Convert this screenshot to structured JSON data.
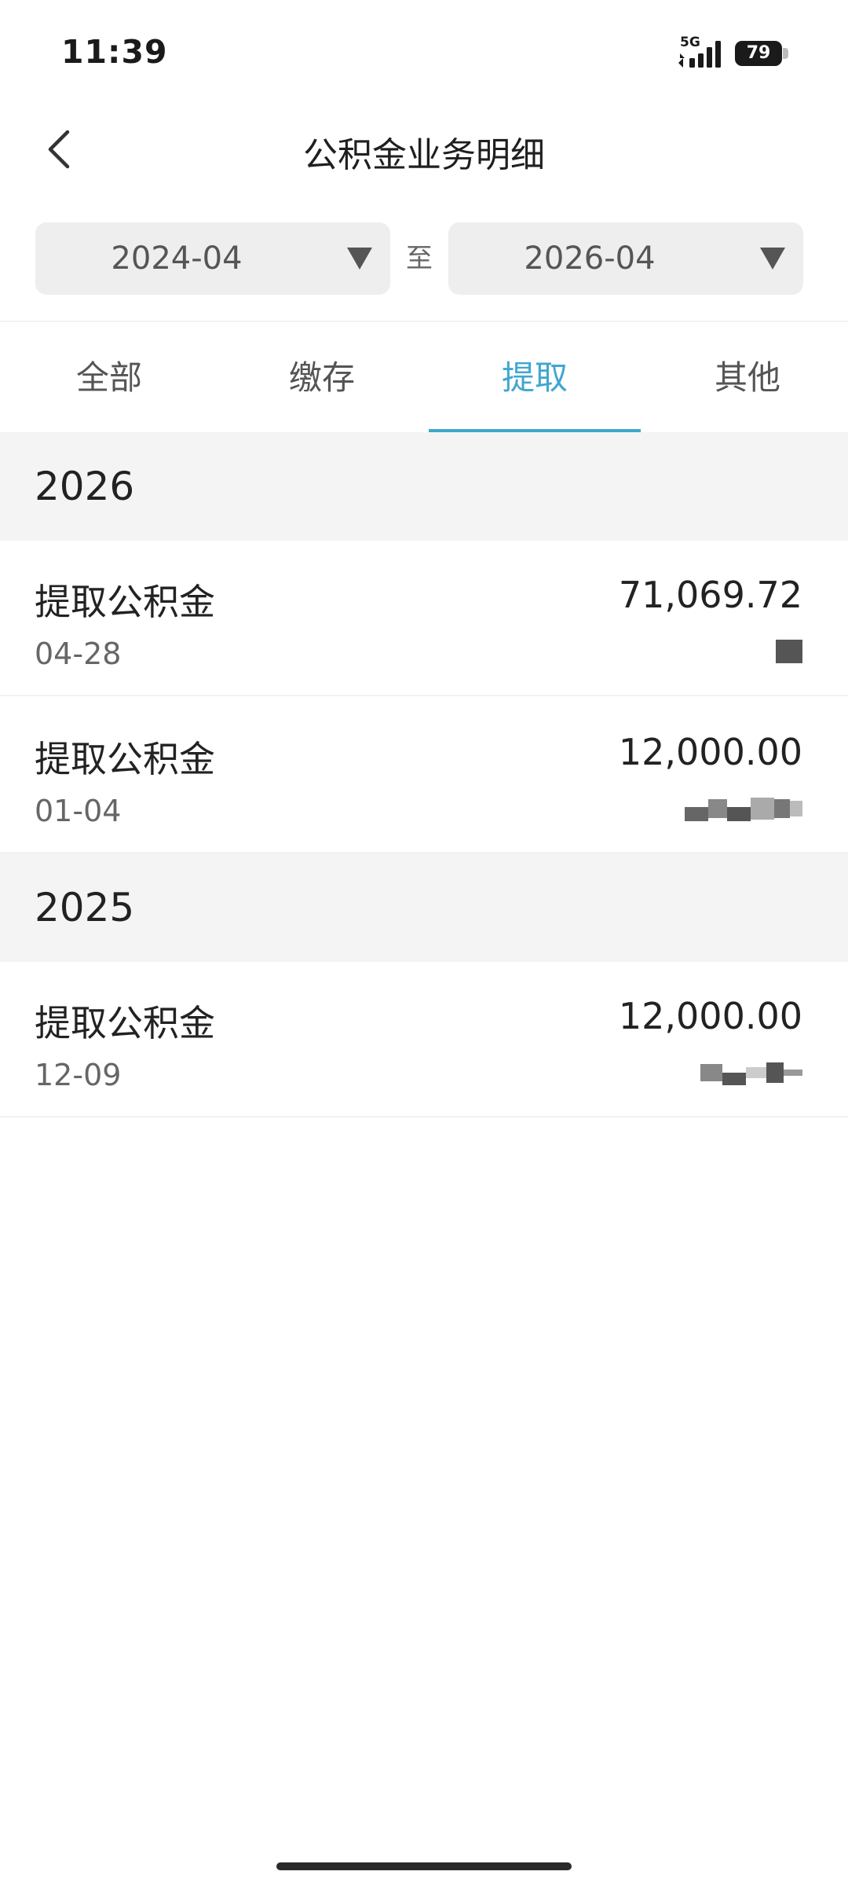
{
  "status_bar": {
    "time": "11:39",
    "network": "5G",
    "battery": "79"
  },
  "header": {
    "title": "公积金业务明细",
    "back_icon": "chevron-left-icon"
  },
  "date_range": {
    "start": "2024-04",
    "separator": "至",
    "end": "2026-04"
  },
  "tabs": [
    {
      "label": "全部"
    },
    {
      "label": "缴存"
    },
    {
      "label": "提取"
    },
    {
      "label": "其他"
    }
  ],
  "active_tab": "提取",
  "accent_color": "#3fa7cf",
  "groups": [
    {
      "year": "2026",
      "records": [
        {
          "title": "提取公积金",
          "date": "04-28",
          "amount": "71,069.72"
        },
        {
          "title": "提取公积金",
          "date": "01-04",
          "amount": "12,000.00"
        }
      ]
    },
    {
      "year": "2025",
      "records": [
        {
          "title": "提取公积金",
          "date": "12-09",
          "amount": "12,000.00"
        }
      ]
    }
  ]
}
